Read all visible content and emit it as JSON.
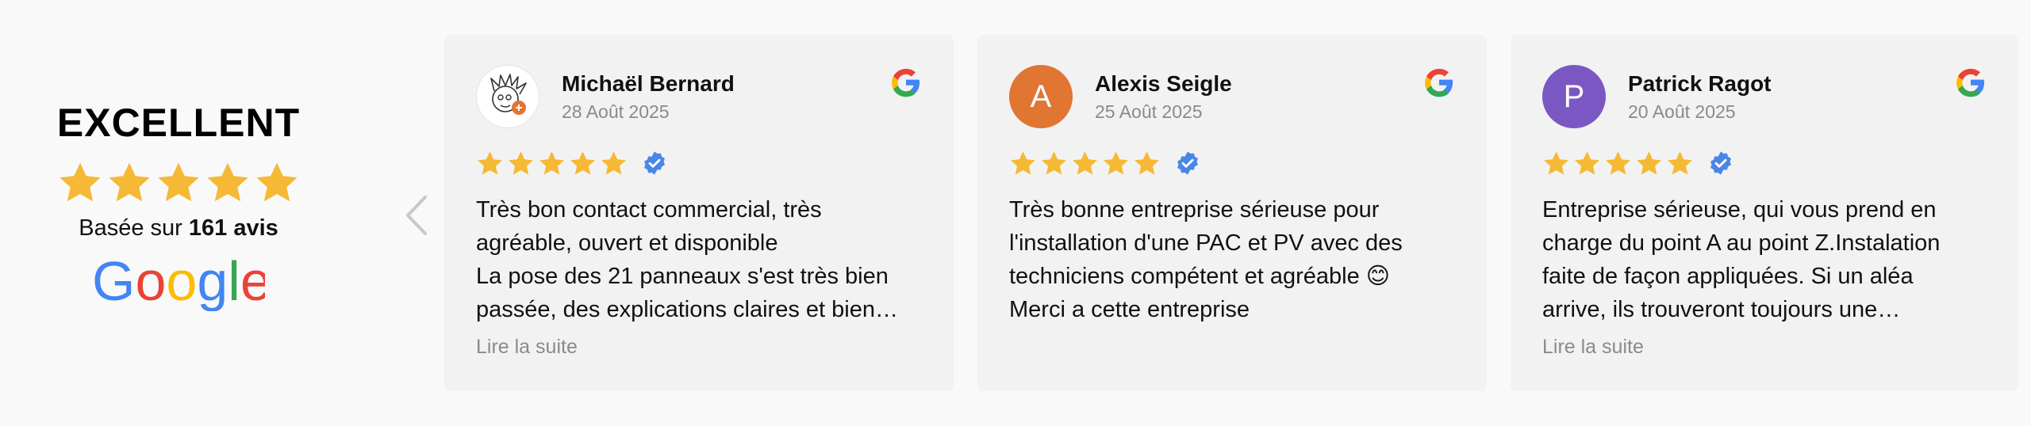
{
  "summary": {
    "rating_label": "EXCELLENT",
    "stars": 5,
    "based_prefix": "Basée sur ",
    "based_count": "161 avis",
    "provider": "Google"
  },
  "colors": {
    "star": "#f5b935",
    "verified": "#4a86e8",
    "card_bg": "#f2f2f2",
    "muted": "#8a8a8a"
  },
  "reviews": [
    {
      "author": "Michaël Bernard",
      "date": "28 Août 2025",
      "avatar": {
        "type": "image",
        "letter": "",
        "color": "#ffffff"
      },
      "stars": 5,
      "verified": true,
      "text_lines": [
        "Très bon contact commercial, très",
        "agréable, ouvert et disponible",
        "La pose des 21 panneaux s'est très bien",
        "passée, des explications claires et bien…"
      ],
      "read_more": "Lire la suite"
    },
    {
      "author": "Alexis Seigle",
      "date": "25 Août 2025",
      "avatar": {
        "type": "letter",
        "letter": "A",
        "color": "#e17532"
      },
      "stars": 5,
      "verified": true,
      "text_lines": [
        "Très bonne entreprise sérieuse pour",
        "l'installation d'une PAC et PV avec des",
        "techniciens compétent et agréable 😊",
        "Merci a cette entreprise"
      ],
      "read_more": ""
    },
    {
      "author": "Patrick Ragot",
      "date": "20 Août 2025",
      "avatar": {
        "type": "letter",
        "letter": "P",
        "color": "#7b57c3"
      },
      "stars": 5,
      "verified": true,
      "text_lines": [
        "Entreprise sérieuse, qui vous prend en",
        "charge du point A au point Z.Instalation",
        "faite de façon appliquées. Si un aléa",
        "arrive, ils trouveront toujours une…"
      ],
      "read_more": "Lire la suite"
    }
  ]
}
